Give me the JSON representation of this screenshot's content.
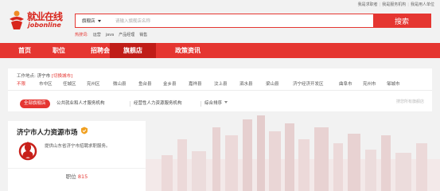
{
  "top_links": [
    "我是求职者",
    "我是服务机构",
    "我是用人单位"
  ],
  "logo": {
    "cn": "就业在线",
    "en": "jobonline"
  },
  "search": {
    "category": "旗舰店",
    "placeholder": "请输入旗舰店名称",
    "button": "搜索"
  },
  "hot": {
    "label": "热搜词:",
    "words": [
      "运营",
      "java",
      "产品经理",
      "销售"
    ]
  },
  "nav": [
    "首页",
    "职位",
    "招聘会",
    "旗舰店",
    "政策资讯"
  ],
  "nav_active": 3,
  "location": {
    "label": "工作地点:",
    "value": "济宁市",
    "change": "[切换城市]"
  },
  "regions": [
    "不限",
    "市中区",
    "任城区",
    "兖州区",
    "微山县",
    "鱼台县",
    "金乡县",
    "嘉祥县",
    "汶上县",
    "泗水县",
    "梁山县",
    "济宁经济开发区",
    "曲阜市",
    "兖州市",
    "邹城市"
  ],
  "types": {
    "all": "全部旗舰店",
    "public": "公共就业和人才服务机构",
    "private": "经营性人力资源服务机构",
    "sort": "综合排序"
  },
  "store_search_placeholder": "搜您所有旗舰店",
  "card": {
    "name": "济宁市人力资源市场",
    "desc": "提供山东省济宁市招聘求职服务。",
    "positions_label": "职位",
    "positions_count": "815"
  },
  "colors": {
    "brand": "#e53631",
    "nav_active": "#c01d18"
  }
}
